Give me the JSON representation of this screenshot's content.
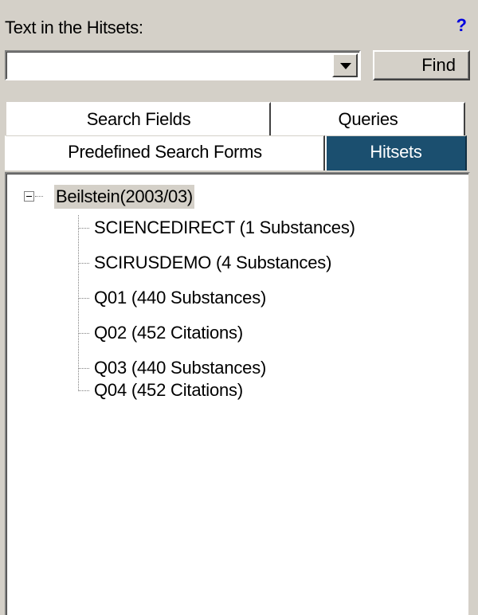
{
  "header": {
    "label": "Text in the Hitsets:",
    "help_glyph": "?"
  },
  "search": {
    "value": "",
    "placeholder": "",
    "find_label": "Find"
  },
  "tabs": {
    "row1": [
      {
        "label": "Search Fields",
        "selected": false
      },
      {
        "label": "Queries",
        "selected": false
      }
    ],
    "row2": [
      {
        "label": "Predefined Search Forms",
        "selected": false
      },
      {
        "label": "Hitsets",
        "selected": true
      }
    ]
  },
  "tree": {
    "root": {
      "label": "Beilstein(2003/03)",
      "expanded": true
    },
    "children": [
      {
        "label": "SCIENCEDIRECT (1 Substances)"
      },
      {
        "label": "SCIRUSDEMO (4 Substances)"
      },
      {
        "label": "Q01 (440 Substances)"
      },
      {
        "label": "Q02 (452 Citations)"
      },
      {
        "label": "Q03 (440 Substances)"
      },
      {
        "label": "Q04 (452 Citations)"
      }
    ]
  },
  "colors": {
    "panel_bg": "#d4d0c8",
    "selected_tab_bg": "#1b4f6f",
    "help_color": "#0000e0"
  }
}
